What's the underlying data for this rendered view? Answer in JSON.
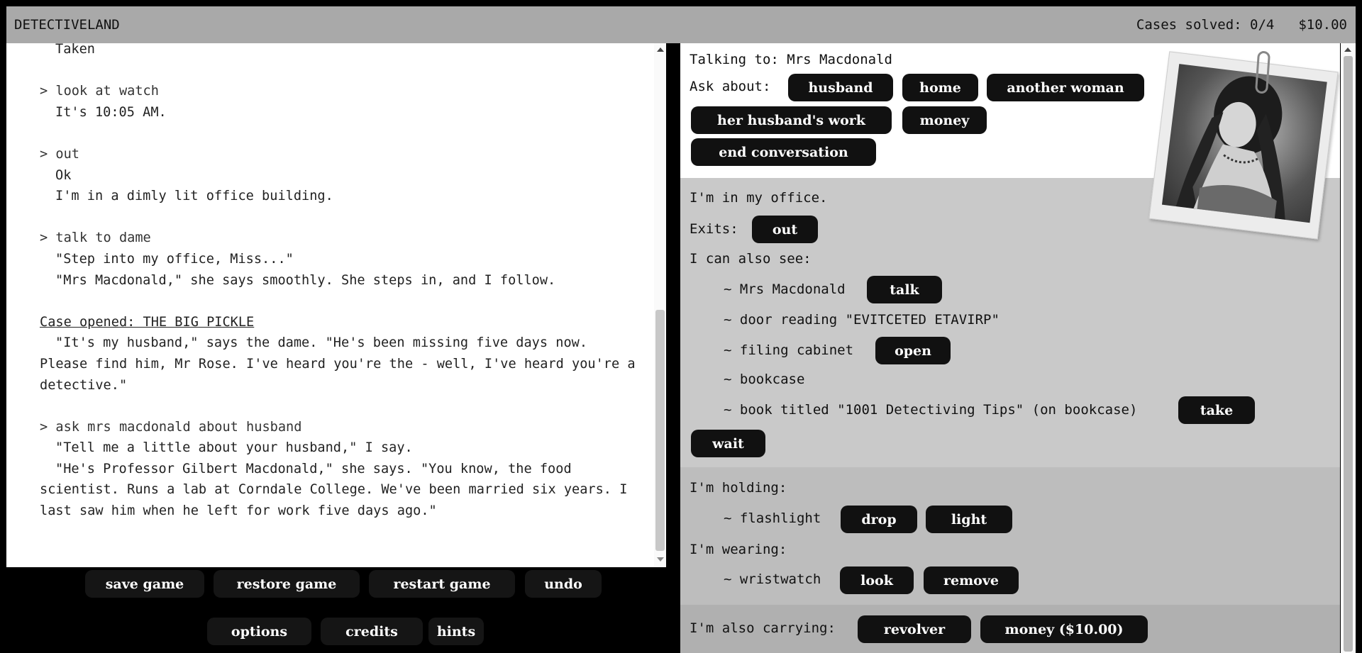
{
  "header": {
    "title": "DETECTIVELAND",
    "cases_solved": "Cases solved: 0/4",
    "money": "$10.00"
  },
  "transcript": {
    "partial_top": "Taken",
    "entries": [
      {
        "command": "> look at watch",
        "output": [
          "It's 10:05 AM."
        ]
      },
      {
        "command": "> out",
        "output": [
          "Ok",
          "I'm in a dimly lit office building."
        ]
      },
      {
        "command": "> talk to dame",
        "output": [
          "\"Step into my office, Miss...\"",
          "\"Mrs Macdonald,\" she says smoothly. She steps in, and I follow."
        ]
      }
    ],
    "case_heading": "Case opened: THE BIG PICKLE",
    "case_text": "\"It's my husband,\" says the dame. \"He's been missing five days now. Please find him, Mr Rose. I've heard you're the - well, I've heard you're a detective.\"",
    "last_command": "> ask mrs macdonald about husband",
    "last_output_1": "\"Tell me a little about your husband,\" I say.",
    "last_output_2": "\"He's Professor Gilbert Macdonald,\" she says. \"You know, the food scientist. Runs a lab at Corndale College. We've been married six years. I last saw him when he left for work five days ago.\""
  },
  "system_buttons": {
    "save": "save game",
    "restore": "restore game",
    "restart": "restart game",
    "undo": "undo",
    "options": "options",
    "credits": "credits",
    "hints": "hints"
  },
  "conversation": {
    "talking_to": "Talking to: Mrs Macdonald",
    "ask_about_label": "Ask about:",
    "topics": [
      "husband",
      "home",
      "another woman",
      "her husband's work",
      "money"
    ],
    "end": "end conversation"
  },
  "room": {
    "description": "I'm in my office.",
    "exits_label": "Exits:",
    "exits": [
      "out"
    ],
    "also_see_label": "I can also see:",
    "objects": [
      {
        "name": "~ Mrs Macdonald",
        "action": "talk"
      },
      {
        "name": "~ door reading \"EVITCETED ETAVIRP\""
      },
      {
        "name": "~ filing cabinet",
        "action": "open"
      },
      {
        "name": "~ bookcase"
      },
      {
        "name": "~ book titled \"1001 Detectiving Tips\" (on bookcase)",
        "action": "take"
      }
    ],
    "wait": "wait"
  },
  "inventory": {
    "holding_label": "I'm holding:",
    "holding_item": "~ flashlight",
    "holding_actions": [
      "drop",
      "light"
    ],
    "wearing_label": "I'm wearing:",
    "wearing_item": "~ wristwatch",
    "wearing_actions": [
      "look",
      "remove"
    ],
    "carrying_label": "I'm also carrying:",
    "carrying_items": [
      "revolver",
      "money ($10.00)"
    ]
  }
}
